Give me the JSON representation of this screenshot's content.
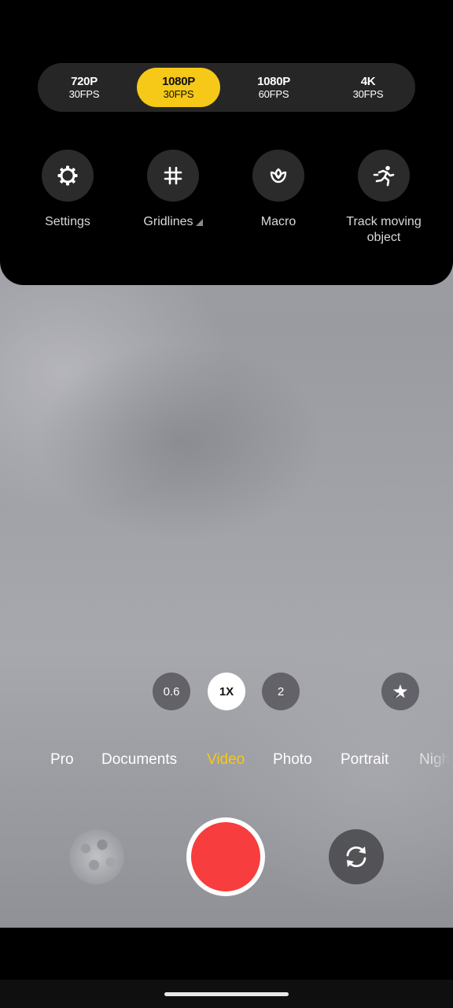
{
  "resolution_options": [
    {
      "main": "720P",
      "sub": "30FPS",
      "selected": false
    },
    {
      "main": "1080P",
      "sub": "30FPS",
      "selected": true
    },
    {
      "main": "1080P",
      "sub": "60FPS",
      "selected": false
    },
    {
      "main": "4K",
      "sub": "30FPS",
      "selected": false
    }
  ],
  "quick_settings": [
    {
      "label": "Settings",
      "icon": "gear-icon"
    },
    {
      "label": "Gridlines",
      "icon": "grid-hash-icon"
    },
    {
      "label": "Macro",
      "icon": "flower-macro-icon"
    },
    {
      "label": "Track moving object",
      "icon": "running-person-icon"
    }
  ],
  "zoom": {
    "options": [
      "0.6",
      "1X",
      "2"
    ],
    "selected": "1X"
  },
  "modes": [
    "Pro",
    "Documents",
    "Video",
    "Photo",
    "Portrait",
    "Nigh"
  ],
  "active_mode": "Video",
  "colors": {
    "accent": "#f6c817",
    "record": "#f73d3d",
    "panel_bg": "#000000"
  },
  "icons": {
    "ai_button": "magic-star-icon",
    "switch_camera": "camera-switch-icon",
    "gallery": "gallery-thumbnail"
  }
}
